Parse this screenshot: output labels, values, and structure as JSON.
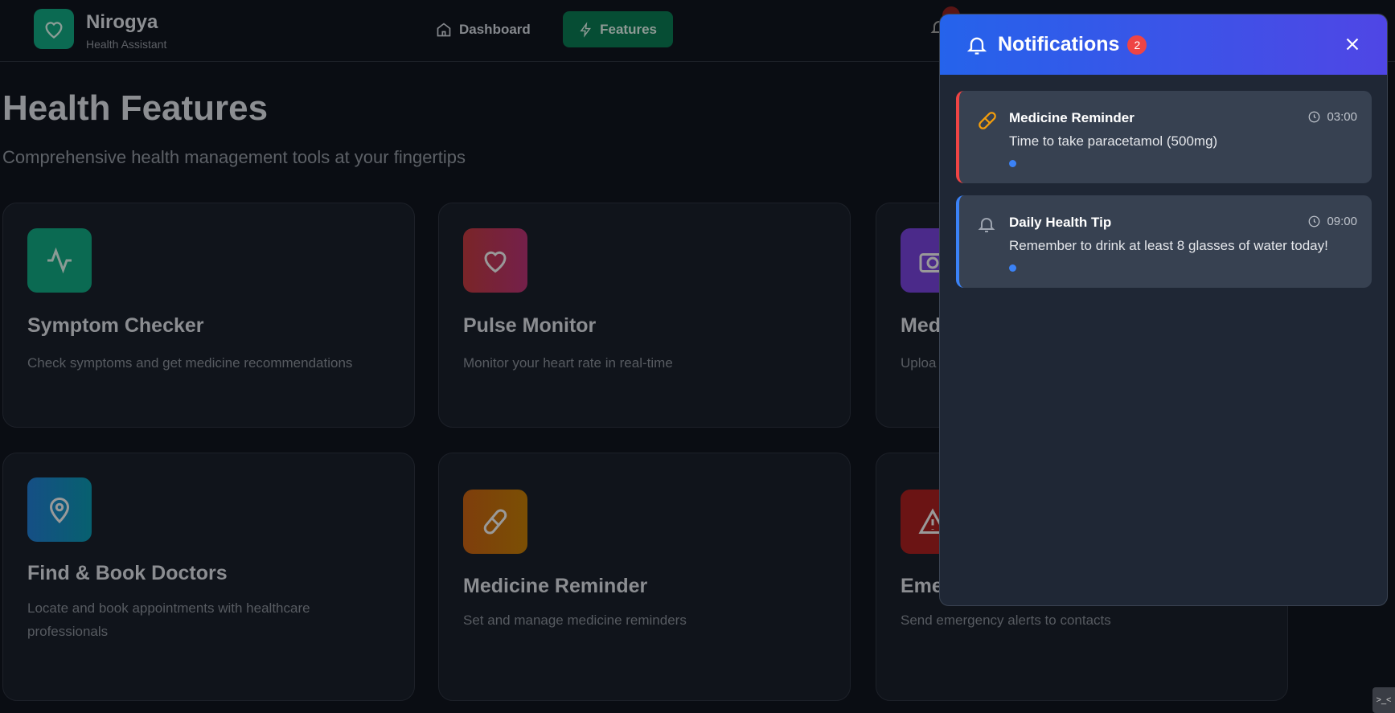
{
  "header": {
    "brand": "Nirogya",
    "brand_sub": "Health Assistant",
    "nav": [
      {
        "label": "Dashboard",
        "icon": "home-icon"
      },
      {
        "label": "Features",
        "icon": "zap-icon",
        "active": true
      }
    ]
  },
  "page": {
    "title": "Health Features",
    "subtitle": "Comprehensive health management tools at your fingertips"
  },
  "cards": [
    {
      "title": "Symptom Checker",
      "desc": "Check symptoms and get medicine recommendations",
      "icon": "activity-icon",
      "color": "#0b6a52"
    },
    {
      "title": "Pulse Monitor",
      "desc": "Monitor your heart rate in real-time",
      "icon": "heart-icon",
      "color": "#7a2530"
    },
    {
      "title": "Med",
      "desc": "Uploa",
      "icon": "camera-icon",
      "color": "#4b2a8a"
    },
    {
      "title": "Find & Book Doctors",
      "desc": "Locate and book appointments with healthcare professionals",
      "icon": "map-pin-icon",
      "color": "#12507a"
    },
    {
      "title": "Medicine Reminder",
      "desc": "Set and manage medicine reminders",
      "icon": "pill-icon",
      "color": "#7a4508"
    },
    {
      "title": "Eme",
      "desc": "Send emergency alerts to contacts",
      "icon": "alert-triangle-icon",
      "color": "#6b1414"
    }
  ],
  "notifications": {
    "title": "Notifications",
    "count": "2",
    "items": [
      {
        "title": "Medicine Reminder",
        "message": "Time to take paracetamol (500mg)",
        "time": "03:00",
        "icon": "pill-icon",
        "accent": "#ef4444"
      },
      {
        "title": "Daily Health Tip",
        "message": "Remember to drink at least 8 glasses of water today!",
        "time": "09:00",
        "icon": "bell-icon",
        "accent": "#3b82f6"
      }
    ]
  },
  "corner_label": ">_<"
}
